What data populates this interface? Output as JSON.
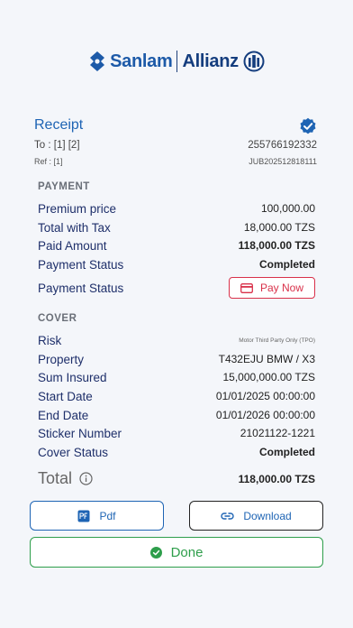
{
  "brand": {
    "left": "Sanlam",
    "right": "Allianz"
  },
  "receipt": {
    "title": "Receipt",
    "to_label": "To",
    "to_value": ": [1] [2]",
    "phone": "255766192332",
    "ref_label": "Ref",
    "ref_value": ": [1]",
    "ref_code": "JUB202512818111"
  },
  "payment": {
    "section_title": "PAYMENT",
    "rows": [
      {
        "label": "Premium price",
        "value": "100,000.00"
      },
      {
        "label": "Total with Tax",
        "value": "18,000.00 TZS"
      },
      {
        "label": "Paid Amount",
        "value": "118,000.00 TZS"
      },
      {
        "label": "Payment Status",
        "value": "Completed"
      }
    ],
    "status_label_2": "Payment Status",
    "pay_now_label": "Pay Now"
  },
  "cover": {
    "section_title": "COVER",
    "rows": [
      {
        "label": "Risk",
        "value": "Motor Third Party Only (TPO)"
      },
      {
        "label": "Property",
        "value": "T432EJU BMW / X3"
      },
      {
        "label": "Sum Insured",
        "value": "15,000,000.00 TZS"
      },
      {
        "label": "Start Date",
        "value": "01/01/2025 00:00:00"
      },
      {
        "label": "End Date",
        "value": "01/01/2026 00:00:00"
      },
      {
        "label": "Sticker Number",
        "value": "21021122-1221"
      },
      {
        "label": "Cover Status",
        "value": "Completed"
      }
    ]
  },
  "total": {
    "label": "Total",
    "value": "118,000.00 TZS"
  },
  "actions": {
    "pdf": "Pdf",
    "download": "Download",
    "done": "Done"
  },
  "colors": {
    "primary": "#1e64b4",
    "danger": "#d9314a",
    "success": "#2e9e4b",
    "background": "#f4f6fa"
  }
}
